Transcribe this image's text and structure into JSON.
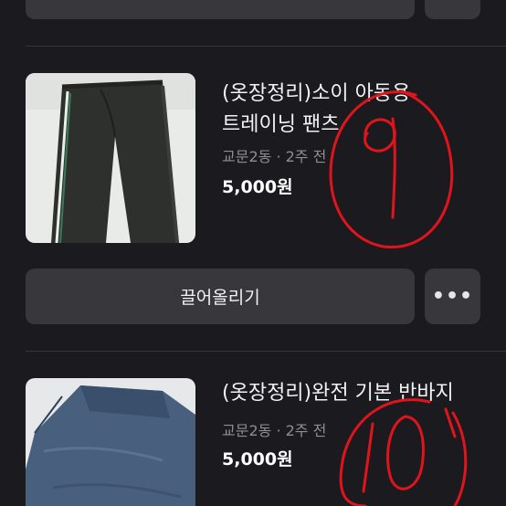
{
  "colors": {
    "background": "#1b1b1f",
    "button_bg": "#38383c",
    "meta_text": "#8e8e93",
    "annotation_red": "#e0141c"
  },
  "top_actions": {
    "more_icon": "more-horizontal-icon"
  },
  "listings": [
    {
      "title": "(옷장정리)소이 아동용\n트레이닝 팬츠",
      "location": "교문2동",
      "separator": "·",
      "time": "2주 전",
      "price": "5,000원",
      "bump_label": "끌어올리기",
      "more_label": "•••"
    },
    {
      "title": "(옷장정리)완전 기본 반바지",
      "location": "교문2동",
      "separator": "·",
      "time": "2주 전",
      "price": "5,000원"
    }
  ]
}
